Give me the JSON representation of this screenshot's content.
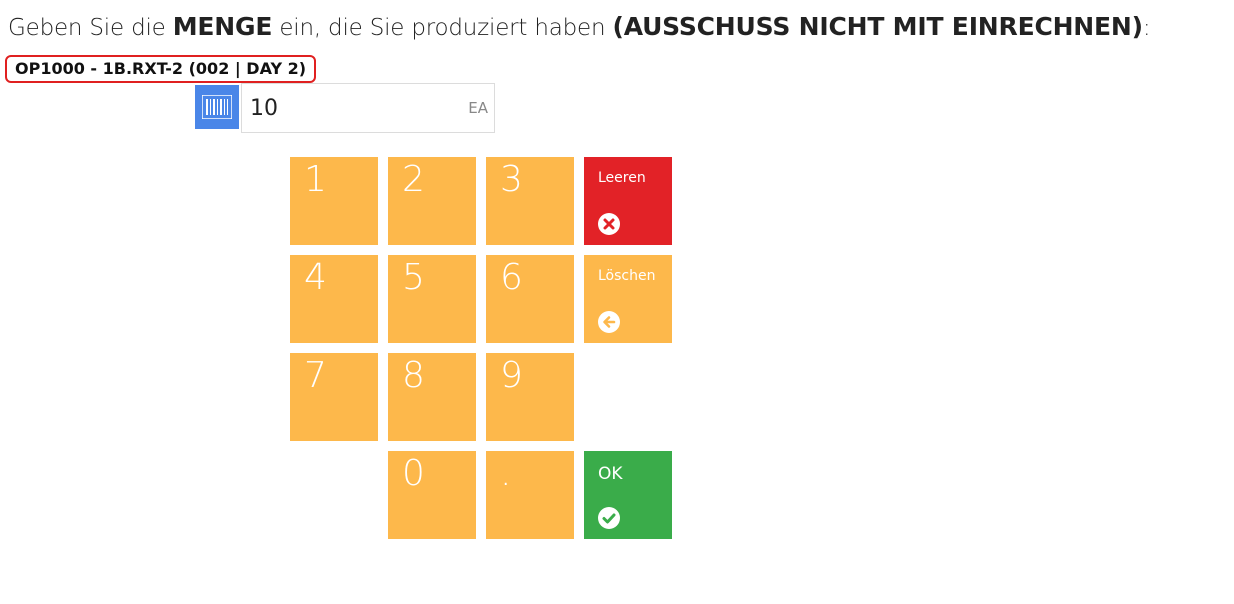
{
  "prompt": {
    "part1": "Geben Sie die ",
    "part2": "MENGE",
    "part3": " ein, die Sie produziert haben ",
    "part4": "(AUSSCHUSS NICHT MIT EINRECHNEN)",
    "part5": ":"
  },
  "order": {
    "label": "OP1000 - 1B.RXT-2 (002 | DAY 2)"
  },
  "quantity": {
    "value": "10",
    "unit": "EA"
  },
  "keypad": {
    "k1": "1",
    "k2": "2",
    "k3": "3",
    "k4": "4",
    "k5": "5",
    "k6": "6",
    "k7": "7",
    "k8": "8",
    "k9": "9",
    "k0": "0",
    "dot": ".",
    "clear_label": "Leeren",
    "clear_icon": "x-circle-icon",
    "delete_label": "Löschen",
    "delete_icon": "arrow-left-circle-icon",
    "ok_label": "OK",
    "ok_icon": "check-circle-icon"
  },
  "colors": {
    "key": "#fdb84b",
    "clear": "#e22227",
    "ok": "#3aac4a",
    "barcode": "#4a86e8"
  }
}
